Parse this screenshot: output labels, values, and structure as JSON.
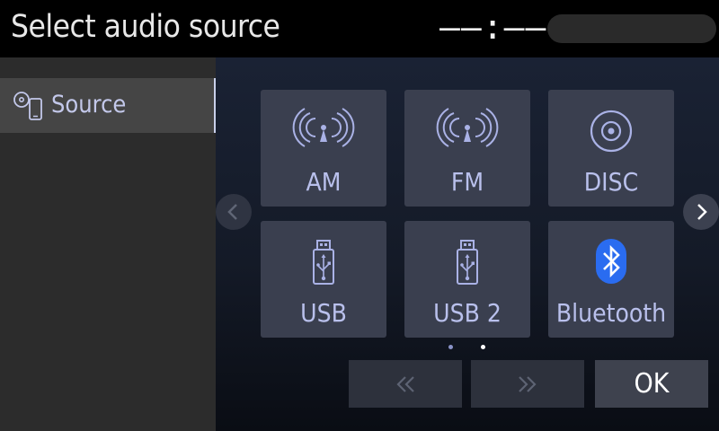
{
  "header": {
    "title": "Select audio source",
    "clock": "––:––"
  },
  "sidebar": {
    "items": [
      {
        "label": "Source",
        "icon": "media-source-icon",
        "selected": true
      }
    ]
  },
  "sources": [
    {
      "label": "AM",
      "icon": "radio-antenna-icon"
    },
    {
      "label": "FM",
      "icon": "radio-antenna-icon"
    },
    {
      "label": "DISC",
      "icon": "disc-icon"
    },
    {
      "label": "USB",
      "icon": "usb-icon"
    },
    {
      "label": "USB 2",
      "icon": "usb-icon"
    },
    {
      "label": "Bluetooth",
      "icon": "bluetooth-icon"
    }
  ],
  "pagination": {
    "current_page": 1,
    "total_pages": 2
  },
  "footer": {
    "ok_label": "OK",
    "rewind_icon": "double-chevron-left-icon",
    "forward_icon": "double-chevron-right-icon"
  },
  "colors": {
    "accent": "#c3c8ea",
    "tile": "#3a3f4f",
    "bluetooth": "#2a6cf0"
  }
}
